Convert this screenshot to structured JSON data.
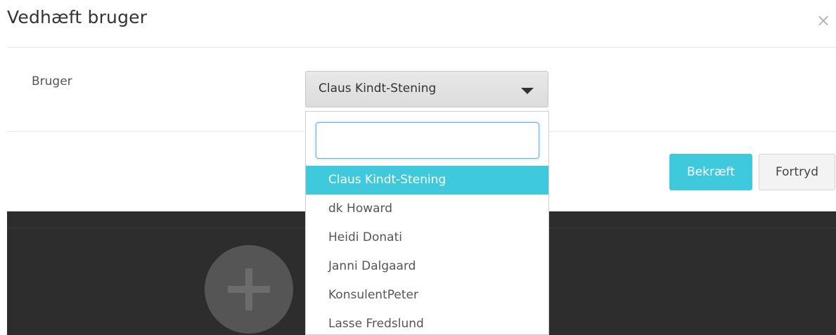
{
  "modal": {
    "title": "Vedhæft bruger",
    "close_glyph": "×"
  },
  "form": {
    "user_label": "Bruger",
    "selected_user": "Claus Kindt-Stening"
  },
  "dropdown": {
    "search_value": "",
    "options": [
      {
        "label": "Claus Kindt-Stening",
        "selected": true
      },
      {
        "label": "dk Howard",
        "selected": false
      },
      {
        "label": "Heidi Donati",
        "selected": false
      },
      {
        "label": "Janni Dalgaard",
        "selected": false
      },
      {
        "label": "KonsulentPeter",
        "selected": false
      },
      {
        "label": "Lasse Fredslund",
        "selected": false
      }
    ]
  },
  "footer": {
    "confirm_label": "Bekræft",
    "cancel_label": "Fortryd"
  },
  "colors": {
    "accent": "#3ec9dc",
    "dark_background": "#2d2d2d"
  },
  "icons": {
    "close": "close-icon",
    "dropdown_arrow": "caret-down-icon",
    "add": "plus-icon"
  }
}
